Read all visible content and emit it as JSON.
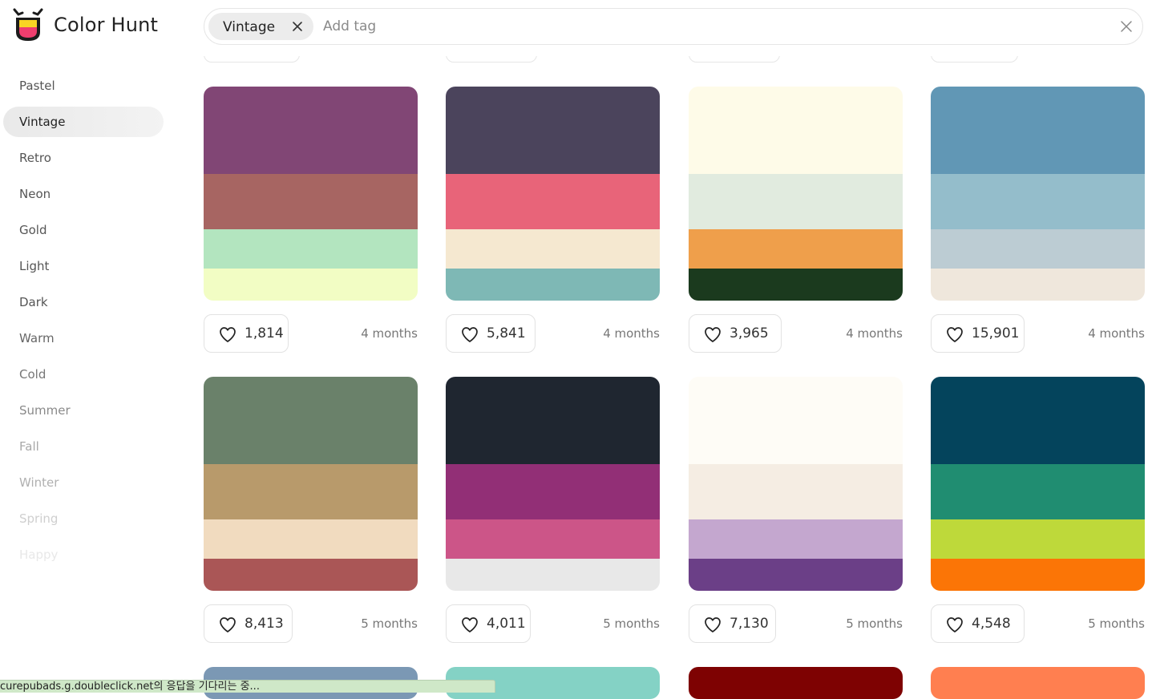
{
  "header": {
    "brand": "Color Hunt",
    "search": {
      "chip_label": "Vintage",
      "placeholder": "Add tag"
    }
  },
  "sidebar": {
    "items": [
      {
        "label": "Pastel",
        "active": false,
        "color": "#555555"
      },
      {
        "label": "Vintage",
        "active": true,
        "color": "#222222"
      },
      {
        "label": "Retro",
        "active": false,
        "color": "#555555"
      },
      {
        "label": "Neon",
        "active": false,
        "color": "#555555"
      },
      {
        "label": "Gold",
        "active": false,
        "color": "#555555"
      },
      {
        "label": "Light",
        "active": false,
        "color": "#555555"
      },
      {
        "label": "Dark",
        "active": false,
        "color": "#555555"
      },
      {
        "label": "Warm",
        "active": false,
        "color": "#666666"
      },
      {
        "label": "Cold",
        "active": false,
        "color": "#777777"
      },
      {
        "label": "Summer",
        "active": false,
        "color": "#8a8a8a"
      },
      {
        "label": "Fall",
        "active": false,
        "color": "#a8a8a8"
      },
      {
        "label": "Winter",
        "active": false,
        "color": "#b0b0b0"
      },
      {
        "label": "Spring",
        "active": false,
        "color": "#cfcfcf"
      },
      {
        "label": "Happy",
        "active": false,
        "color": "#e8e8e8"
      }
    ]
  },
  "palettes": [
    {
      "colors": [
        "#814675",
        "#A76562",
        "#B3E5BF",
        "#F2FDC4"
      ],
      "likes": "1,814",
      "age": "4 months"
    },
    {
      "colors": [
        "#4B445C",
        "#E86479",
        "#F5E8D0",
        "#7EB8B5"
      ],
      "likes": "5,841",
      "age": "4 months"
    },
    {
      "colors": [
        "#FEFBE8",
        "#E1EBDF",
        "#EF9F4B",
        "#1B3A1E"
      ],
      "likes": "3,965",
      "age": "4 months"
    },
    {
      "colors": [
        "#6197B5",
        "#94BDCB",
        "#BCCCD3",
        "#EFE7DC"
      ],
      "likes": "15,901",
      "age": "4 months"
    },
    {
      "colors": [
        "#6A816A",
        "#B89A6B",
        "#F1DBBF",
        "#AA5656"
      ],
      "likes": "8,413",
      "age": "5 months"
    },
    {
      "colors": [
        "#1F2630",
        "#922F76",
        "#CC5588",
        "#E8E8E8"
      ],
      "likes": "4,011",
      "age": "5 months"
    },
    {
      "colors": [
        "#FEFCF6",
        "#F5EDE3",
        "#C4A7CF",
        "#6B3F87"
      ],
      "likes": "7,130",
      "age": "5 months"
    },
    {
      "colors": [
        "#04445C",
        "#208D71",
        "#BED93A",
        "#FB7506"
      ],
      "likes": "4,548",
      "age": "5 months"
    }
  ],
  "next_row_colors": [
    "#7B98B4",
    "#84D2C5",
    "#7E0202",
    "#FF7F50"
  ],
  "status_bar": {
    "text": "curepubads.g.doubleclick.net의 응답을 기다리는 중..."
  },
  "colors": {
    "logo_yellow": "#F9D423",
    "logo_pink": "#EF3E6E",
    "logo_outline": "#1c1c1c"
  }
}
